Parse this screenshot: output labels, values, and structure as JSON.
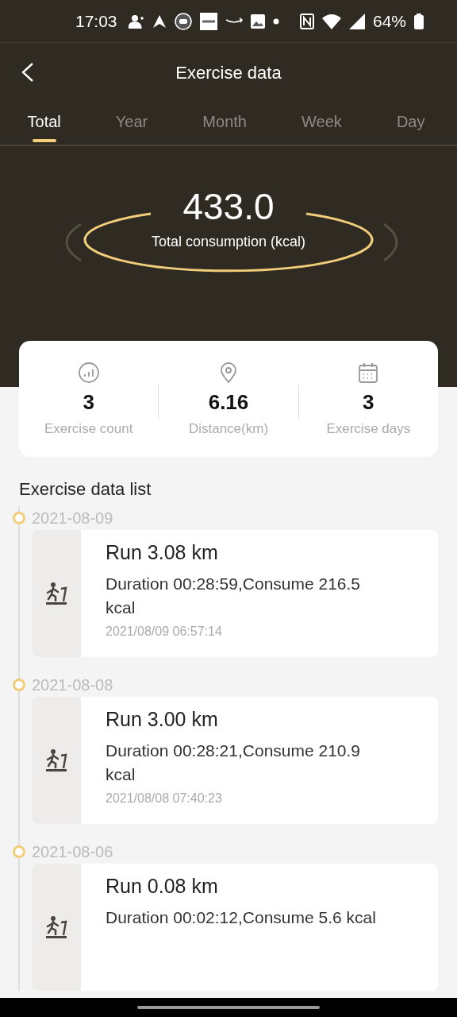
{
  "status_bar": {
    "time": "17:03",
    "battery": "64%"
  },
  "header": {
    "title": "Exercise data"
  },
  "tabs": [
    {
      "label": "Total",
      "selected": true
    },
    {
      "label": "Year",
      "selected": false
    },
    {
      "label": "Month",
      "selected": false
    },
    {
      "label": "Week",
      "selected": false
    },
    {
      "label": "Day",
      "selected": false
    }
  ],
  "summary": {
    "value": "433.0",
    "label": "Total consumption (kcal)"
  },
  "stats": [
    {
      "kind": "count",
      "value": "3",
      "label": "Exercise count"
    },
    {
      "kind": "distance",
      "value": "6.16",
      "label": "Distance(km)"
    },
    {
      "kind": "days",
      "value": "3",
      "label": "Exercise days"
    }
  ],
  "list": {
    "title": "Exercise data list",
    "entries": [
      {
        "date": "2021-08-09",
        "title": "Run 3.08 km",
        "detail": "Duration 00:28:59,Consume 216.5 kcal",
        "timestamp": "2021/08/09 06:57:14"
      },
      {
        "date": "2021-08-08",
        "title": "Run 3.00 km",
        "detail": "Duration 00:28:21,Consume 210.9 kcal",
        "timestamp": "2021/08/08 07:40:23"
      },
      {
        "date": "2021-08-06",
        "title": "Run 0.08 km",
        "detail": "Duration 00:02:12,Consume 5.6 kcal"
      }
    ]
  }
}
